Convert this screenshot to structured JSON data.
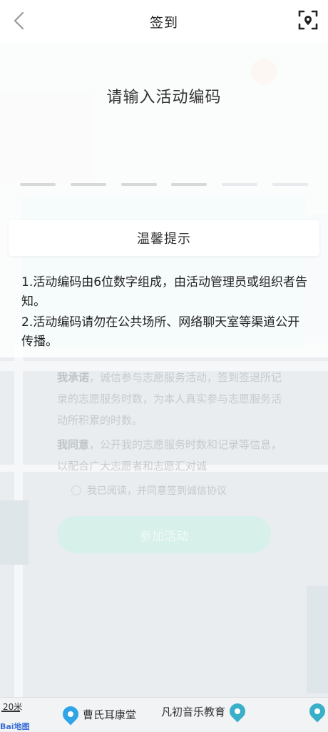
{
  "header": {
    "title": "签到",
    "back_icon": "chevron-left-icon",
    "scan_icon": "scan-icon"
  },
  "prompt": {
    "title": "请输入活动编码",
    "code_length": 6
  },
  "tips": {
    "title": "温馨提示",
    "lines": [
      "1.活动编码由6位数字组成，由活动管理员或组织者告知。",
      "2.活动编码请勿在公共场所、网络聊天室等渠道公开传播。"
    ]
  },
  "background": {
    "promise_label": "我承诺",
    "promise_text": "，诚信参与志愿服务活动，签到签退所记录的志愿服务时数，为本人真实参与志愿服务活动所积累的时数。",
    "agree_label": "我同意",
    "agree_text": "，公开我的志愿服务时数和记录等信息，以配合广大志愿者和志愿汇对诚",
    "checkbox_label": "我已阅读，并同意签到诚信协议",
    "join_button": "参加活动"
  },
  "map": {
    "scale_text": "20米",
    "logo_text": "Bai地图",
    "pois": [
      "曹氏耳康堂",
      "凡初音乐教育"
    ]
  },
  "colors": {
    "header_bg": "#ffffff",
    "accent_teal": "#d7f0ea",
    "text_primary": "#222222"
  }
}
